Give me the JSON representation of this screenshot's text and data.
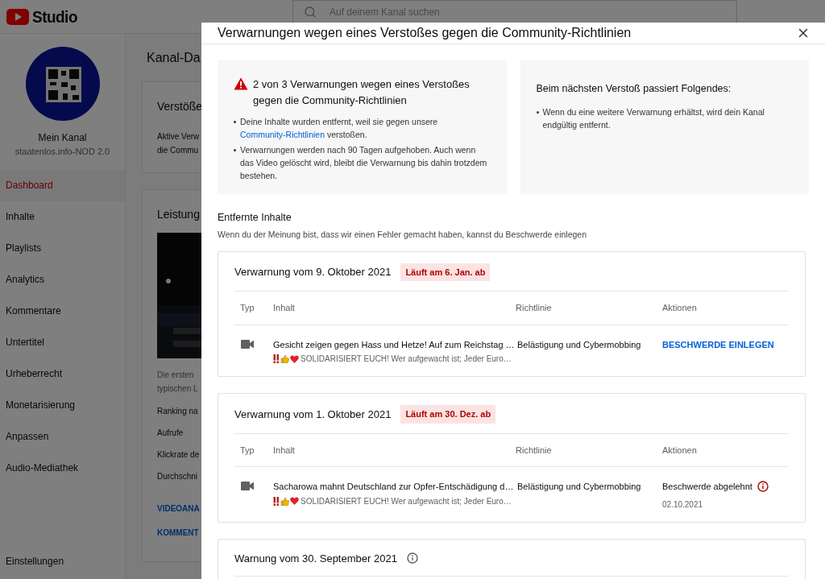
{
  "header": {
    "logo_text": "Studio",
    "search": {
      "placeholder": "Auf deinem Kanal suchen"
    }
  },
  "channel": {
    "name": "Mein Kanal",
    "subtitle": "staatenlos.info-NOD 2.0"
  },
  "sidebar": {
    "items": [
      {
        "label": "Dashboard",
        "selected": true
      },
      {
        "label": "Inhalte",
        "selected": false
      },
      {
        "label": "Playlists",
        "selected": false
      },
      {
        "label": "Analytics",
        "selected": false
      },
      {
        "label": "Kommentare",
        "selected": false
      },
      {
        "label": "Untertitel",
        "selected": false
      },
      {
        "label": "Urheberrecht",
        "selected": false
      },
      {
        "label": "Monetarisierung",
        "selected": false
      },
      {
        "label": "Anpassen",
        "selected": false
      },
      {
        "label": "Audio-Mediathek",
        "selected": false
      }
    ],
    "footer_item": "Einstellungen"
  },
  "main": {
    "title": "Kanal-Da",
    "violations_card": {
      "title": "Verstöße",
      "lines": [
        "Aktive Verw",
        "die Commu"
      ]
    },
    "performance_card": {
      "title": "Leistung",
      "description": [
        "Die ersten",
        "typischen L"
      ],
      "metrics": [
        "Ranking na",
        "Aufrufe",
        "Klickrate de",
        "Durchschni"
      ],
      "links": [
        "VIDEOANA",
        "KOMMENT"
      ]
    }
  },
  "dialog": {
    "title": "Verwarnungen wegen eines Verstoßes gegen die Community-Richtlinien",
    "summary": {
      "title": "2 von 3 Verwarnungen wegen eines Verstoßes gegen die Community-Richtlinien",
      "bullets": [
        {
          "before": "Deine Inhalte wurden entfernt, weil sie gegen unsere ",
          "link": "Community-Richtlinien",
          "after": " verstoßen."
        },
        {
          "before": "Verwarnungen werden nach 90 Tagen aufgehoben. Auch wenn das Video gelöscht wird, bleibt die Verwarnung bis dahin trotzdem bestehen."
        }
      ]
    },
    "next": {
      "title": "Beim nächsten Verstoß passiert Folgendes:",
      "bullets": [
        "Wenn du eine weitere Verwarnung erhältst, wird dein Kanal endgültig entfernt."
      ]
    },
    "removed": {
      "title": "Entfernte Inhalte",
      "subtitle": "Wenn du der Meinung bist, dass wir einen Fehler gemacht haben, kannst du Beschwerde einlegen"
    },
    "strikes": [
      {
        "kind": "strike",
        "title": "Verwarnung vom 9. Oktober 2021",
        "badge": "Läuft am 6. Jan. ab",
        "columns": [
          "Typ",
          "Inhalt",
          "Richtlinie",
          "Aktionen"
        ],
        "rows": [
          {
            "title": "Gesicht zeigen gegen Hass und Hetze! Auf zum Reichstag …",
            "description": "SOLIDARISIERT EUCH! Wer aufgewacht ist; Jeder Euro…",
            "policy": "Belästigung und Cybermobbing",
            "action": {
              "kind": "button",
              "label": "BESCHWERDE EINLEGEN"
            }
          }
        ]
      },
      {
        "kind": "strike",
        "title": "Verwarnung vom 1. Oktober 2021",
        "badge": "Läuft am 30. Dez. ab",
        "columns": [
          "Typ",
          "Inhalt",
          "Richtlinie",
          "Aktionen"
        ],
        "rows": [
          {
            "title": "Sacharowa mahnt Deutschland zur Opfer-Entschädigung d…",
            "description": "SOLIDARISIERT EUCH! Wer aufgewacht ist; Jeder Euro…",
            "policy": "Belästigung und Cybermobbing",
            "action": {
              "kind": "status",
              "label": "Beschwerde abgelehnt",
              "date": "02.10.2021"
            }
          }
        ]
      },
      {
        "kind": "warning",
        "title": "Warnung vom 30. September 2021"
      }
    ]
  }
}
